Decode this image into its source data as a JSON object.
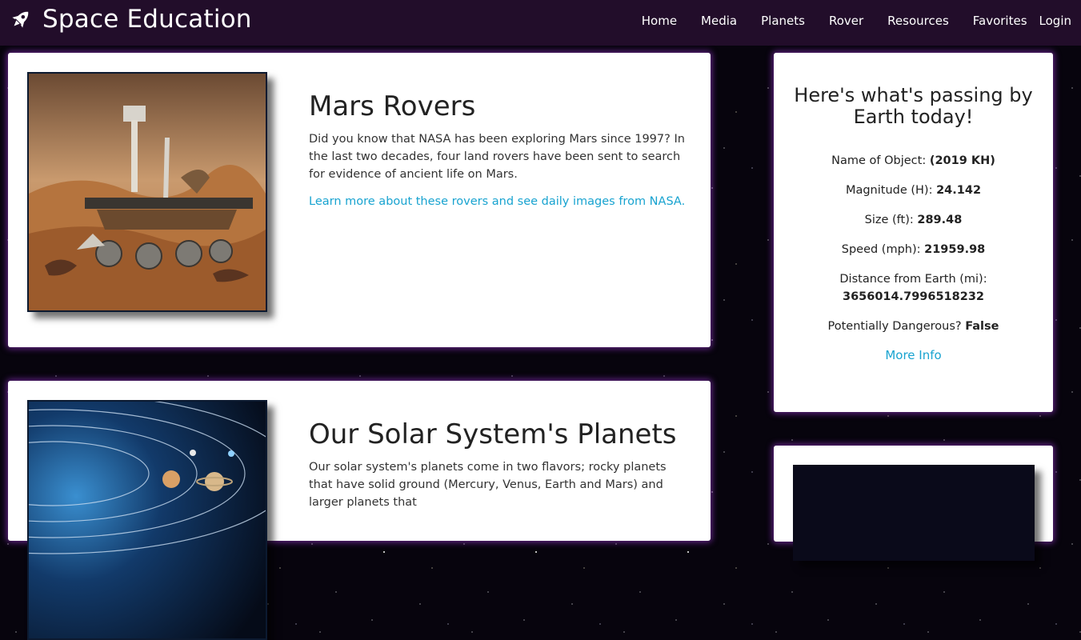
{
  "nav": {
    "brand": "Space Education",
    "links": [
      "Home",
      "Media",
      "Planets",
      "Rover",
      "Resources",
      "Favorites",
      "Login"
    ]
  },
  "cards": [
    {
      "title": "Mars Rovers",
      "body": "Did you know that NASA has been exploring Mars since 1997? In the last two decades, four land rovers have been sent to search for evidence of ancient life on Mars.",
      "link": "Learn more about these rovers and see daily images from NASA."
    },
    {
      "title": "Our Solar System's Planets",
      "body": "Our solar system's planets come in two flavors; rocky planets that have solid ground (Mercury, Venus, Earth and Mars) and larger planets that"
    }
  ],
  "neo": {
    "title": "Here's what's passing by Earth today!",
    "name_label": "Name of Object:",
    "name_value": "(2019 KH)",
    "magnitude_label": "Magnitude (H):",
    "magnitude_value": "24.142",
    "size_label": "Size (ft):",
    "size_value": "289.48",
    "speed_label": "Speed (mph):",
    "speed_value": "21959.98",
    "distance_label": "Distance from Earth (mi):",
    "distance_value": "3656014.7996518232",
    "danger_label": "Potentially Dangerous?",
    "danger_value": "False",
    "more_info": "More Info"
  },
  "colors": {
    "navbar": "#220d2a",
    "link": "#18a3d0",
    "card_glow": "#aa3ce6"
  }
}
